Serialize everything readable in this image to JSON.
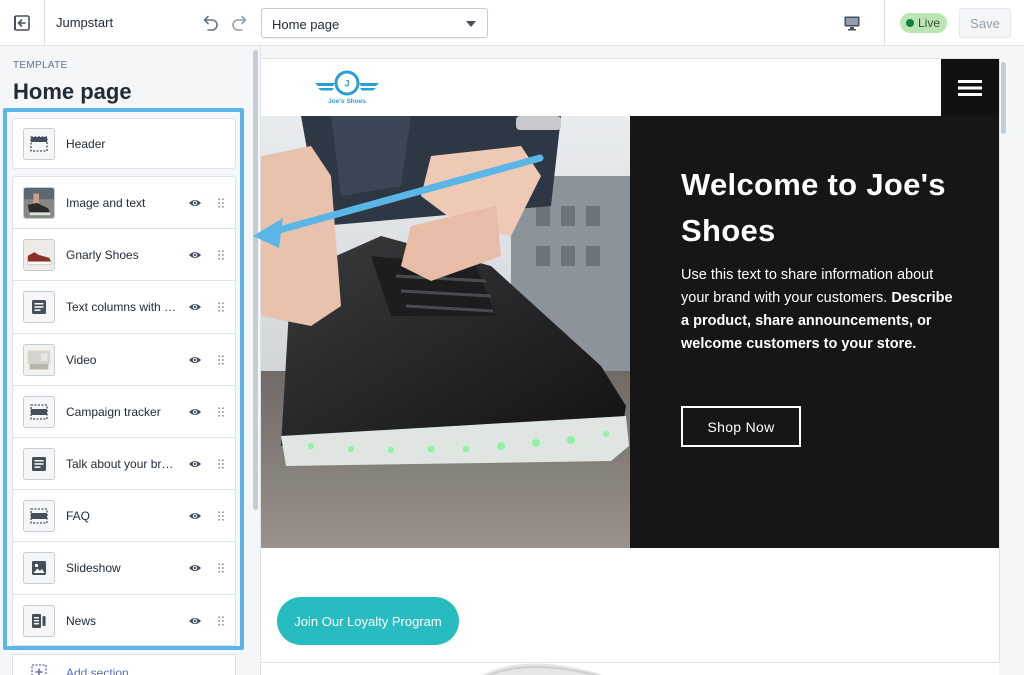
{
  "topbar": {
    "app_title": "Jumpstart",
    "page_select_value": "Home page",
    "live_label": "Live",
    "save_label": "Save"
  },
  "sidebar": {
    "template_label": "TEMPLATE",
    "template_title": "Home page",
    "header_section": {
      "label": "Header",
      "icon": "header-layout-icon"
    },
    "sections": [
      {
        "label": "Image and text",
        "thumb": "photo-boots-thumb"
      },
      {
        "label": "Gnarly Shoes",
        "thumb": "photo-shoe-thumb"
      },
      {
        "label": "Text columns with images",
        "thumb": "text-columns-icon"
      },
      {
        "label": "Video",
        "thumb": "photo-video-thumb"
      },
      {
        "label": "Campaign tracker",
        "thumb": "layout-icon"
      },
      {
        "label": "Talk about your brand",
        "thumb": "text-block-icon"
      },
      {
        "label": "FAQ",
        "thumb": "layout-icon"
      },
      {
        "label": "Slideshow",
        "thumb": "image-icon"
      },
      {
        "label": "News",
        "thumb": "blog-icon"
      }
    ],
    "add_section_label": "Add section"
  },
  "preview": {
    "logo_letter": "J",
    "logo_text": "Joe's Shoes",
    "hero_heading": "Welcome to Joe's Shoes",
    "hero_body_regular": "Use this text to share information about your brand with your customers.",
    "hero_body_bold": "Describe a product, share announcements, or welcome customers to your store.",
    "hero_button": "Shop Now",
    "loyalty_button": "Join Our Loyalty Program"
  },
  "colors": {
    "highlight_frame": "#5bb6e8",
    "live_badge": "#bbe5b3",
    "live_dot": "#108043",
    "hero_bg": "#161616",
    "loyalty_button": "#27bcc0",
    "logo_blue": "#2a9ed8",
    "add_section_link": "#5c6ac4"
  }
}
